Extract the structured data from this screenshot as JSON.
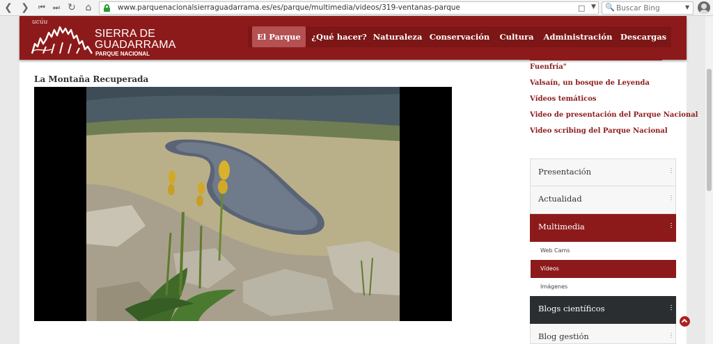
{
  "browser": {
    "url": "www.parquenacionalsierraguadarrama.es/es/parque/multimedia/videos/319-ventanas-parque",
    "search_placeholder": "Buscar Bing",
    "back_icon": "chevron-left-icon",
    "forward_icon": "chevron-right-icon"
  },
  "site": {
    "logo_signature": "ucúu",
    "logo_line1": "SIERRA DE",
    "logo_line2": "GUADARRAMA",
    "logo_line3": "PARQUE NACIONAL",
    "nav": [
      "El Parque",
      "¿Qué hacer?",
      "Naturaleza",
      "Conservación",
      "Cultura",
      "Administración",
      "Descargas"
    ],
    "brand_color": "#8d1a1a"
  },
  "main": {
    "video_title": "La Montaña Recuperada"
  },
  "sidebar": {
    "video_links": [
      "Fuenfría\"",
      "Valsaín, un bosque de Leyenda",
      "Vídeos temáticos",
      "Video de presentación del Parque Nacional",
      "Video scribing del Parque Nacional"
    ],
    "menu": {
      "presentacion": "Presentación",
      "actualidad": "Actualidad",
      "multimedia": "Multimedia",
      "sub": [
        "Web Cams",
        "Vídeos",
        "Imágenes"
      ],
      "blogs_cientificos": "Blogs científicos",
      "blog_gestion": "Blog gestión"
    }
  }
}
